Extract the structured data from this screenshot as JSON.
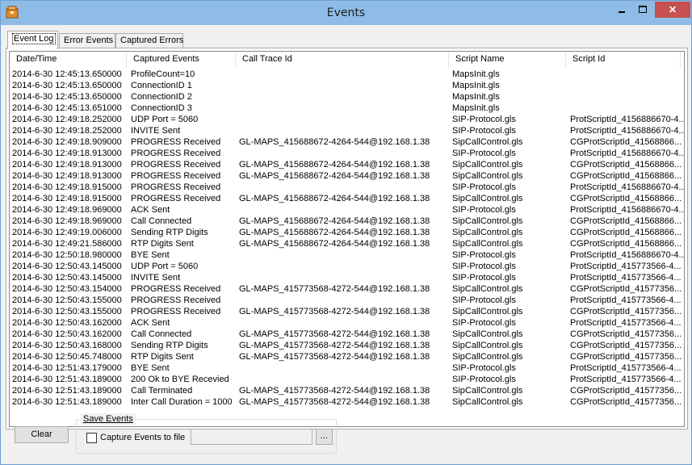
{
  "window": {
    "title": "Events"
  },
  "tabs": [
    "Event Log",
    "Error Events",
    "Captured Errors"
  ],
  "columns": [
    "Date/Time",
    "Captured Events",
    "Call Trace Id",
    "Script Name",
    "Script Id"
  ],
  "rows": [
    [
      "2014-6-30 12:45:13.650000",
      "ProfileCount=10",
      "",
      "MapsInit.gls",
      ""
    ],
    [
      "2014-6-30 12:45:13.650000",
      "ConnectionID 1",
      "",
      "MapsInit.gls",
      ""
    ],
    [
      "2014-6-30 12:45:13.650000",
      "ConnectionID 2",
      "",
      "MapsInit.gls",
      ""
    ],
    [
      "2014-6-30 12:45:13.651000",
      "ConnectionID 3",
      "",
      "MapsInit.gls",
      ""
    ],
    [
      "2014-6-30 12:49:18.252000",
      "UDP Port = 5060",
      "",
      "SIP-Protocol.gls",
      "ProtScriptId_4156886670-4..."
    ],
    [
      "2014-6-30 12:49:18.252000",
      "INVITE Sent",
      "",
      "SIP-Protocol.gls",
      "ProtScriptId_4156886670-4..."
    ],
    [
      "2014-6-30 12:49:18.909000",
      "PROGRESS Received",
      "GL-MAPS_415688672-4264-544@192.168.1.38",
      "SipCallControl.gls",
      "CGProtScriptId_41568866..."
    ],
    [
      "2014-6-30 12:49:18.913000",
      "PROGRESS Received",
      "",
      "SIP-Protocol.gls",
      "ProtScriptId_4156886670-4..."
    ],
    [
      "2014-6-30 12:49:18.913000",
      "PROGRESS Received",
      "GL-MAPS_415688672-4264-544@192.168.1.38",
      "SipCallControl.gls",
      "CGProtScriptId_41568866..."
    ],
    [
      "2014-6-30 12:49:18.913000",
      "PROGRESS Received",
      "GL-MAPS_415688672-4264-544@192.168.1.38",
      "SipCallControl.gls",
      "CGProtScriptId_41568866..."
    ],
    [
      "2014-6-30 12:49:18.915000",
      "PROGRESS Received",
      "",
      "SIP-Protocol.gls",
      "ProtScriptId_4156886670-4..."
    ],
    [
      "2014-6-30 12:49:18.915000",
      "PROGRESS Received",
      "GL-MAPS_415688672-4264-544@192.168.1.38",
      "SipCallControl.gls",
      "CGProtScriptId_41568866..."
    ],
    [
      "2014-6-30 12:49:18.969000",
      "ACK Sent",
      "",
      "SIP-Protocol.gls",
      "ProtScriptId_4156886670-4..."
    ],
    [
      "2014-6-30 12:49:18.969000",
      "Call Connected",
      "GL-MAPS_415688672-4264-544@192.168.1.38",
      "SipCallControl.gls",
      "CGProtScriptId_41568866..."
    ],
    [
      "2014-6-30 12:49:19.006000",
      "Sending RTP Digits",
      "GL-MAPS_415688672-4264-544@192.168.1.38",
      "SipCallControl.gls",
      "CGProtScriptId_41568866..."
    ],
    [
      "2014-6-30 12:49:21.586000",
      "RTP Digits Sent",
      "GL-MAPS_415688672-4264-544@192.168.1.38",
      "SipCallControl.gls",
      "CGProtScriptId_41568866..."
    ],
    [
      "2014-6-30 12:50:18.980000",
      "BYE Sent",
      "",
      "SIP-Protocol.gls",
      "ProtScriptId_4156886670-4..."
    ],
    [
      "2014-6-30 12:50:43.145000",
      "UDP Port = 5060",
      "",
      "SIP-Protocol.gls",
      "ProtScriptId_415773566-4..."
    ],
    [
      "2014-6-30 12:50:43.145000",
      "INVITE Sent",
      "",
      "SIP-Protocol.gls",
      "ProtScriptId_415773566-4..."
    ],
    [
      "2014-6-30 12:50:43.154000",
      "PROGRESS Received",
      "GL-MAPS_415773568-4272-544@192.168.1.38",
      "SipCallControl.gls",
      "CGProtScriptId_41577356..."
    ],
    [
      "2014-6-30 12:50:43.155000",
      "PROGRESS Received",
      "",
      "SIP-Protocol.gls",
      "ProtScriptId_415773566-4..."
    ],
    [
      "2014-6-30 12:50:43.155000",
      "PROGRESS Received",
      "GL-MAPS_415773568-4272-544@192.168.1.38",
      "SipCallControl.gls",
      "CGProtScriptId_41577356..."
    ],
    [
      "2014-6-30 12:50:43.162000",
      "ACK Sent",
      "",
      "SIP-Protocol.gls",
      "ProtScriptId_415773566-4..."
    ],
    [
      "2014-6-30 12:50:43.162000",
      "Call Connected",
      "GL-MAPS_415773568-4272-544@192.168.1.38",
      "SipCallControl.gls",
      "CGProtScriptId_41577356..."
    ],
    [
      "2014-6-30 12:50:43.168000",
      "Sending RTP Digits",
      "GL-MAPS_415773568-4272-544@192.168.1.38",
      "SipCallControl.gls",
      "CGProtScriptId_41577356..."
    ],
    [
      "2014-6-30 12:50:45.748000",
      "RTP Digits Sent",
      "GL-MAPS_415773568-4272-544@192.168.1.38",
      "SipCallControl.gls",
      "CGProtScriptId_41577356..."
    ],
    [
      "2014-6-30 12:51:43.179000",
      "BYE Sent",
      "",
      "SIP-Protocol.gls",
      "ProtScriptId_415773566-4..."
    ],
    [
      "2014-6-30 12:51:43.189000",
      "200 Ok to BYE Recevied",
      "",
      "SIP-Protocol.gls",
      "ProtScriptId_415773566-4..."
    ],
    [
      "2014-6-30 12:51:43.189000",
      "Call Terminated",
      "GL-MAPS_415773568-4272-544@192.168.1.38",
      "SipCallControl.gls",
      "CGProtScriptId_41577356..."
    ],
    [
      "2014-6-30 12:51:43.189000",
      "Inter Call Duration = 1000",
      "GL-MAPS_415773568-4272-544@192.168.1.38",
      "SipCallControl.gls",
      "CGProtScriptId_41577356..."
    ]
  ],
  "footer": {
    "clear_label": "Clear",
    "group_label": "Save Events",
    "capture_label": "Capture Events to file",
    "capture_checked": false,
    "file_value": "",
    "browse_label": "..."
  },
  "icons": {
    "app": "app-icon",
    "minimize": "minimize-icon",
    "maximize": "maximize-icon",
    "close": "close-icon"
  },
  "colors": {
    "titlebar": "#8fbce6",
    "close_button": "#c75050",
    "panel": "#f0f0f0"
  }
}
